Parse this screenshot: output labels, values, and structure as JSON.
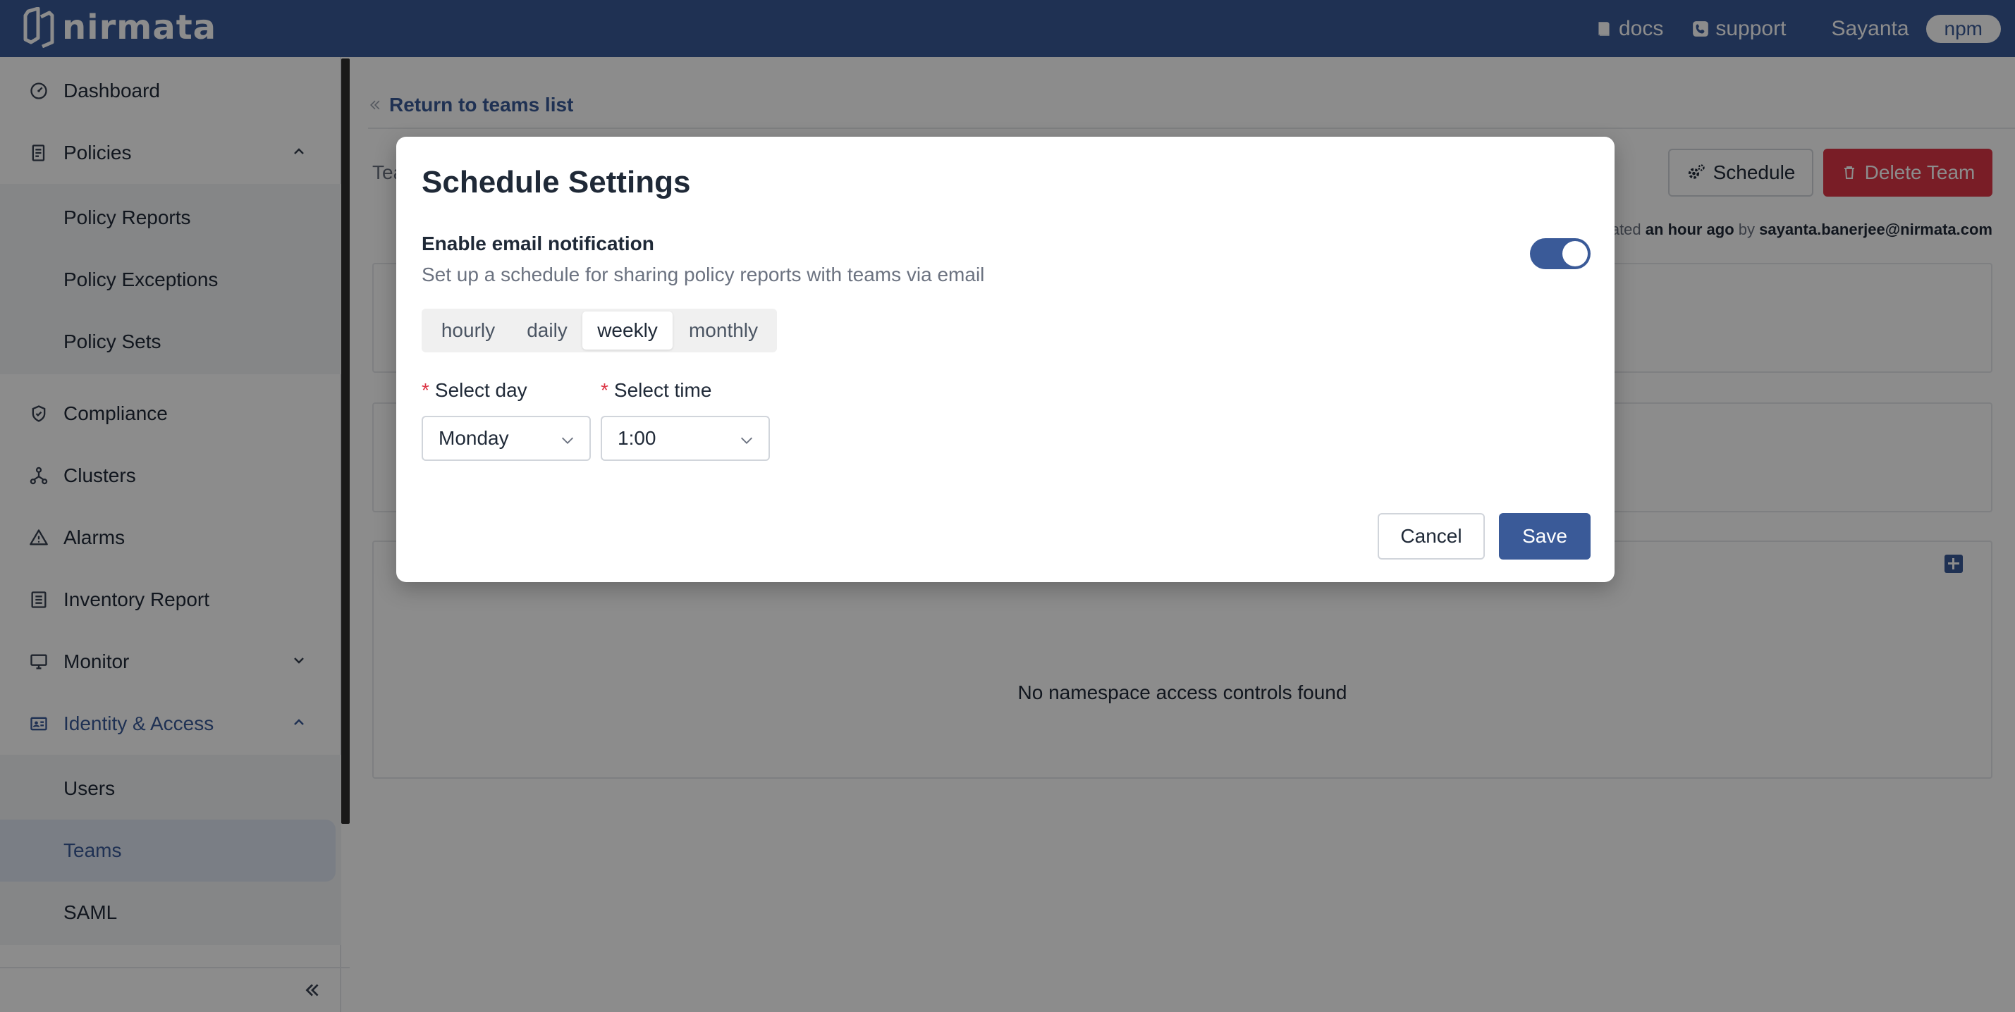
{
  "header": {
    "brand": "nirmata",
    "docs_label": "docs",
    "support_label": "support",
    "user_name": "Sayanta",
    "tenant_badge": "npm"
  },
  "sidebar": {
    "items": [
      {
        "label": "Dashboard",
        "icon": "dashboard-icon"
      },
      {
        "label": "Policies",
        "icon": "policy-icon"
      },
      {
        "label": "Compliance",
        "icon": "shield-icon"
      },
      {
        "label": "Clusters",
        "icon": "cluster-icon"
      },
      {
        "label": "Alarms",
        "icon": "warning-icon"
      },
      {
        "label": "Inventory Report",
        "icon": "list-icon"
      },
      {
        "label": "Monitor",
        "icon": "monitor-icon"
      },
      {
        "label": "Identity & Access",
        "icon": "id-card-icon"
      }
    ],
    "policies_sub": [
      "Policy Reports",
      "Policy Exceptions",
      "Policy Sets"
    ],
    "identity_sub": [
      "Users",
      "Teams",
      "SAML"
    ],
    "active_item": "Teams"
  },
  "main": {
    "return_link": "Return to teams list",
    "team_label_partial": "Tea",
    "schedule_button": "Schedule",
    "delete_button": "Delete Team",
    "info_prefix": "ated",
    "info_time": "an hour ago",
    "info_by": "by",
    "info_user": "sayanta.banerjee@nirmata.com",
    "empty_namespace_text": "No namespace access controls found"
  },
  "modal": {
    "title": "Schedule Settings",
    "notification_title": "Enable email notification",
    "notification_desc": "Set up a schedule for sharing policy reports with teams via email",
    "toggle_on": true,
    "frequency_options": [
      "hourly",
      "daily",
      "weekly",
      "monthly"
    ],
    "selected_frequency": "weekly",
    "select_day_label": "Select day",
    "select_time_label": "Select time",
    "day_value": "Monday",
    "time_value": "1:00",
    "cancel_label": "Cancel",
    "save_label": "Save"
  },
  "colors": {
    "primary": "#3a5a98",
    "danger": "#dc3545",
    "overlay": "rgba(0,0,0,0.45)"
  }
}
